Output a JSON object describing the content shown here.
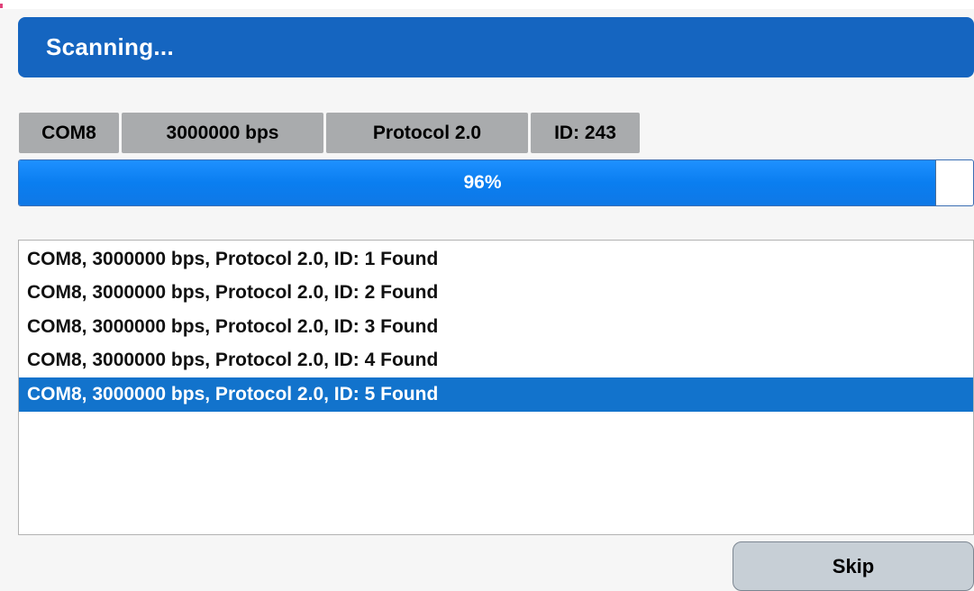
{
  "header": {
    "title": "Scanning..."
  },
  "status_chips": {
    "port": "COM8",
    "baud": "3000000 bps",
    "protocol": "Protocol 2.0",
    "id": "ID: 243"
  },
  "progress": {
    "value_fraction": 0.96,
    "label": "96%"
  },
  "results": {
    "items": [
      "COM8, 3000000 bps, Protocol 2.0, ID: 1 Found",
      "COM8, 3000000 bps, Protocol 2.0, ID: 2 Found",
      "COM8, 3000000 bps, Protocol 2.0, ID: 3 Found",
      "COM8, 3000000 bps, Protocol 2.0, ID: 4 Found",
      "COM8, 3000000 bps, Protocol 2.0, ID: 5 Found"
    ],
    "selected_index": 4
  },
  "actions": {
    "skip_label": "Skip"
  },
  "colors": {
    "header_bg": "#1565c0",
    "chip_bg": "#a9abad",
    "progress_fill": "#0a7ef0",
    "selected_row_bg": "#1273cc",
    "button_bg": "#c7cfd6"
  }
}
